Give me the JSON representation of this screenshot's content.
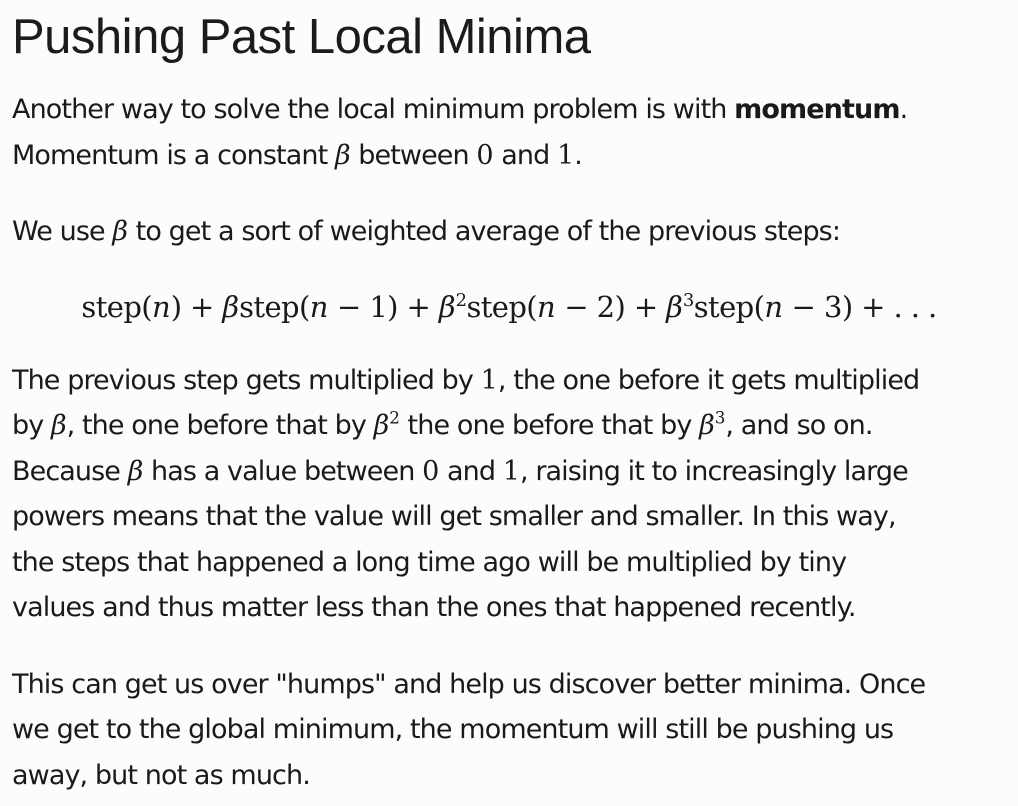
{
  "heading": "Pushing Past Local Minima",
  "beta": "β",
  "zero": "0",
  "one": "1",
  "two": "2",
  "three": "3",
  "p1": {
    "a": "Another way to solve the local minimum problem is with ",
    "bold": "momentum",
    "b": ".",
    "c": "Momentum is a constant ",
    "d": " between ",
    "e": " and ",
    "f": "."
  },
  "p2": {
    "a": "We use ",
    "b": " to get a sort of weighted average of the previous steps:"
  },
  "equation": {
    "step_n": "step(",
    "n": "n",
    "close": ")",
    "plus": " + ",
    "minus": " − ",
    "ellipsis": " + . . ."
  },
  "p3": {
    "a": "The previous step gets multiplied by ",
    "b": ", the one before it gets multiplied",
    "c": "by ",
    "d": ", the one before that by ",
    "e": " the one before that by ",
    "f": ", and so on.",
    "g": "Because ",
    "h": " has a value between ",
    "i": " and ",
    "j": ", raising it to increasingly large",
    "k": "powers means that the value will get smaller and smaller. In this way,",
    "l": "the steps that happened a long time ago will be multiplied by tiny",
    "m": "values and thus matter less than the ones that happened recently."
  },
  "p4": {
    "a": "This can get us over \"humps\" and help us discover better minima. Once",
    "b": "we get to the global minimum, the momentum will still be pushing us",
    "c": "away, but not as much."
  }
}
